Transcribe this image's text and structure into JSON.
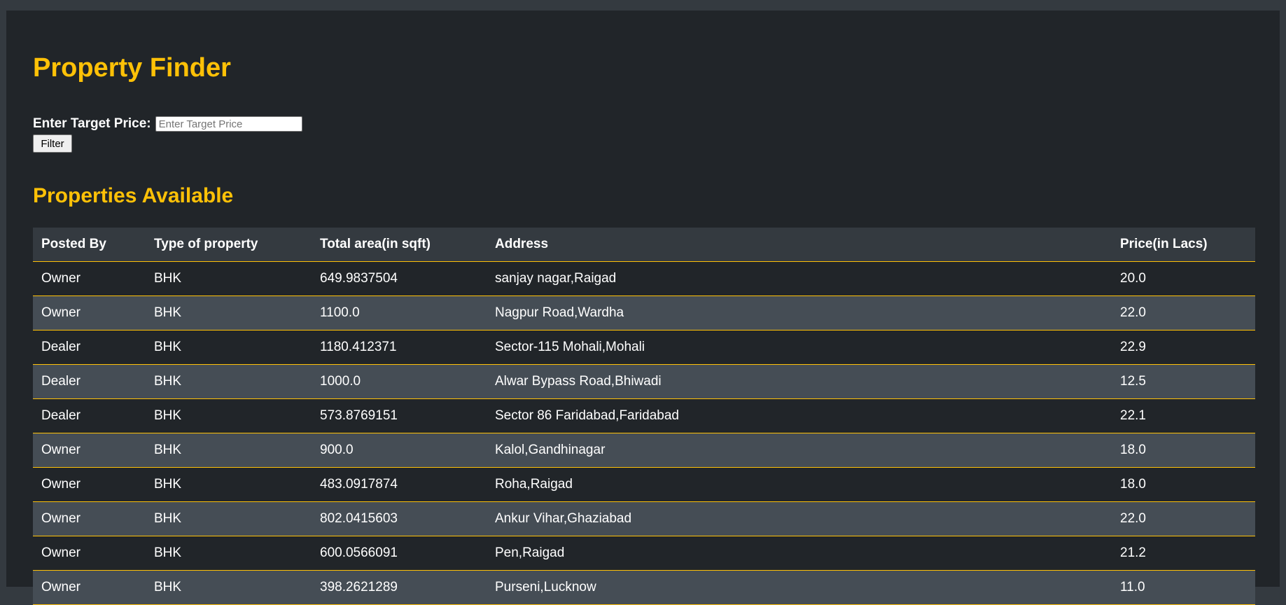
{
  "page": {
    "title": "Property Finder",
    "section_title": "Properties Available"
  },
  "filter": {
    "label": "Enter Target Price:",
    "placeholder": "Enter Target Price",
    "value": "",
    "button_label": "Filter"
  },
  "table": {
    "headers": [
      "Posted By",
      "Type of property",
      "Total area(in sqft)",
      "Address",
      "Price(in Lacs)"
    ],
    "rows": [
      [
        "Owner",
        "BHK",
        "649.9837504",
        "sanjay nagar,Raigad",
        "20.0"
      ],
      [
        "Owner",
        "BHK",
        "1100.0",
        "Nagpur Road,Wardha",
        "22.0"
      ],
      [
        "Dealer",
        "BHK",
        "1180.412371",
        "Sector-115 Mohali,Mohali",
        "22.9"
      ],
      [
        "Dealer",
        "BHK",
        "1000.0",
        "Alwar Bypass Road,Bhiwadi",
        "12.5"
      ],
      [
        "Dealer",
        "BHK",
        "573.8769151",
        "Sector 86 Faridabad,Faridabad",
        "22.1"
      ],
      [
        "Owner",
        "BHK",
        "900.0",
        "Kalol,Gandhinagar",
        "18.0"
      ],
      [
        "Owner",
        "BHK",
        "483.0917874",
        "Roha,Raigad",
        "18.0"
      ],
      [
        "Owner",
        "BHK",
        "802.0415603",
        "Ankur Vihar,Ghaziabad",
        "22.0"
      ],
      [
        "Owner",
        "BHK",
        "600.0566091",
        "Pen,Raigad",
        "21.2"
      ],
      [
        "Owner",
        "BHK",
        "398.2621289",
        "Purseni,Lucknow",
        "11.0"
      ]
    ]
  },
  "colors": {
    "accent": "#ffc107",
    "background": "#212529",
    "outer_background": "#343a40",
    "row_alt": "#454d55"
  }
}
